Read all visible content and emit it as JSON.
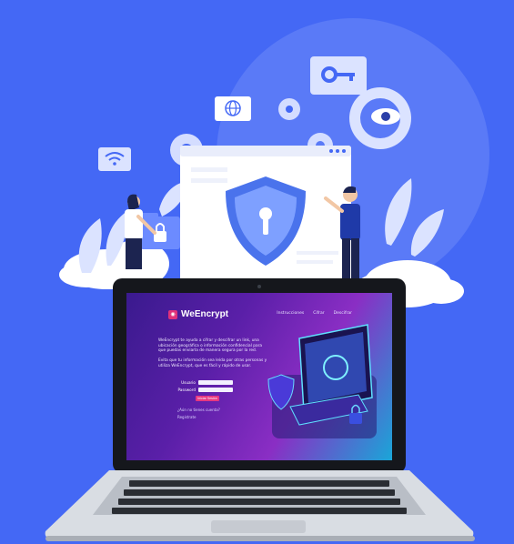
{
  "colors": {
    "background": "#4468f5",
    "accent": "#e63880",
    "shield": "#4a73ec"
  },
  "icons": [
    "wifi-icon",
    "globe-icon",
    "key-icon",
    "eye-gear-icon",
    "gear-icon",
    "shield-lock-icon",
    "padlock-icon"
  ],
  "app": {
    "name": "WeEncrypt",
    "nav": [
      "Instrucciones",
      "Cifrar",
      "Descifrar"
    ],
    "intro": "WeEncrypt te ayuda a cifrar y descifrar un link, una ubicación geográfica o información confidencial para que puedas enviarla de manera segura por la red.",
    "intro2": "Evita que tu información sea leída por otras personas y utiliza WeEncrypt, que es fácil y rápido de usar.",
    "username_label": "Usuario",
    "password_label": "Password",
    "login_button": "Iniciar Sesión",
    "no_account": "¿Aún no tienes cuenta?",
    "register": "Registrate"
  }
}
